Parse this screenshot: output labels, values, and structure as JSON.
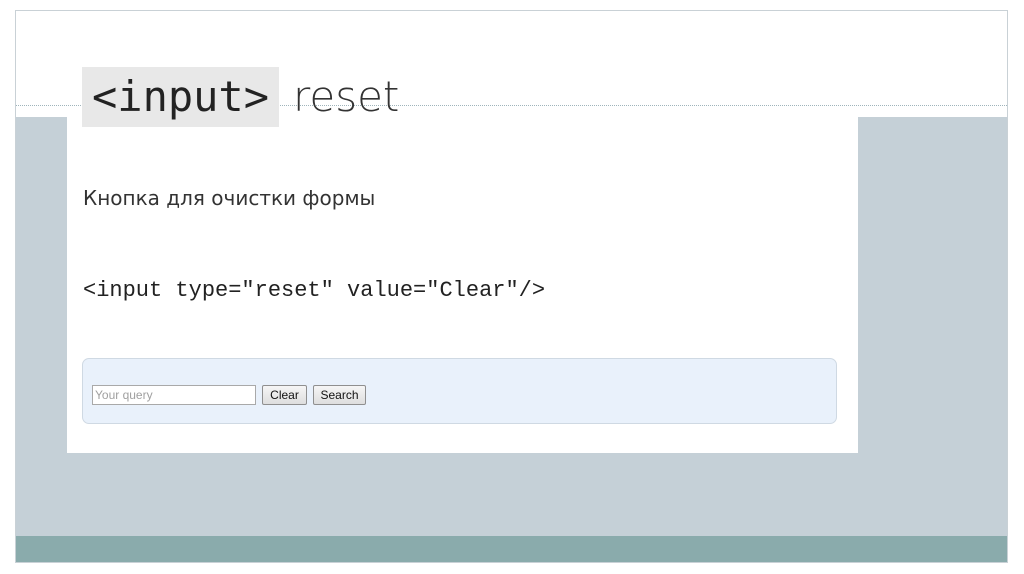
{
  "slide": {
    "title_tag": "<input>",
    "title_word": "reset",
    "subtitle": "Кнопка для очистки формы",
    "code": "<input type=\"reset\" value=\"Clear\"/>"
  },
  "demo_form": {
    "query_placeholder": "Your query",
    "clear_label": "Clear",
    "search_label": "Search"
  },
  "colors": {
    "band_gray": "#c5d0d7",
    "band_teal": "#8aabac",
    "form_bg": "#e9f1fb"
  }
}
